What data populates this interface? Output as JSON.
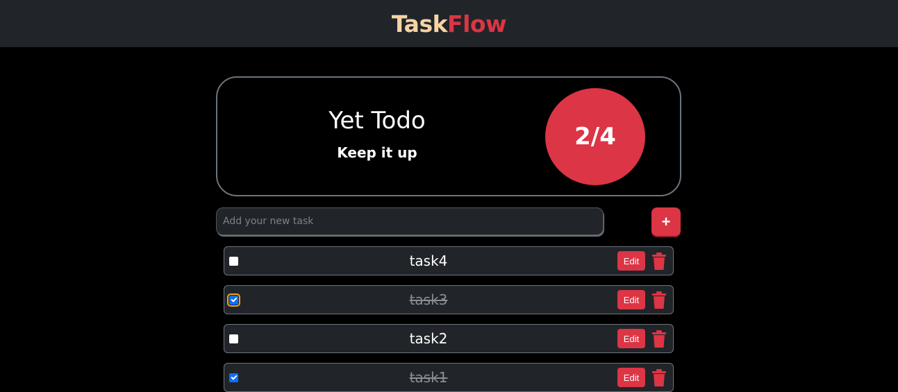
{
  "brand": {
    "part1": "Task",
    "part2": "Flow"
  },
  "summary": {
    "title": "Yet Todo",
    "subtitle": "Keep it up",
    "progress": "2/4"
  },
  "new_task": {
    "placeholder": "Add your new task",
    "add_label": "+"
  },
  "tasks": [
    {
      "name": "task4",
      "done": false,
      "edit_label": "Edit"
    },
    {
      "name": "task3",
      "done": true,
      "edit_label": "Edit"
    },
    {
      "name": "task2",
      "done": false,
      "edit_label": "Edit"
    },
    {
      "name": "task1",
      "done": true,
      "edit_label": "Edit"
    }
  ],
  "colors": {
    "accent": "#dc3545",
    "brand_light": "#f6d3a6",
    "surface": "#212529",
    "background": "#000000"
  },
  "icons": {
    "delete": "trash-icon"
  }
}
